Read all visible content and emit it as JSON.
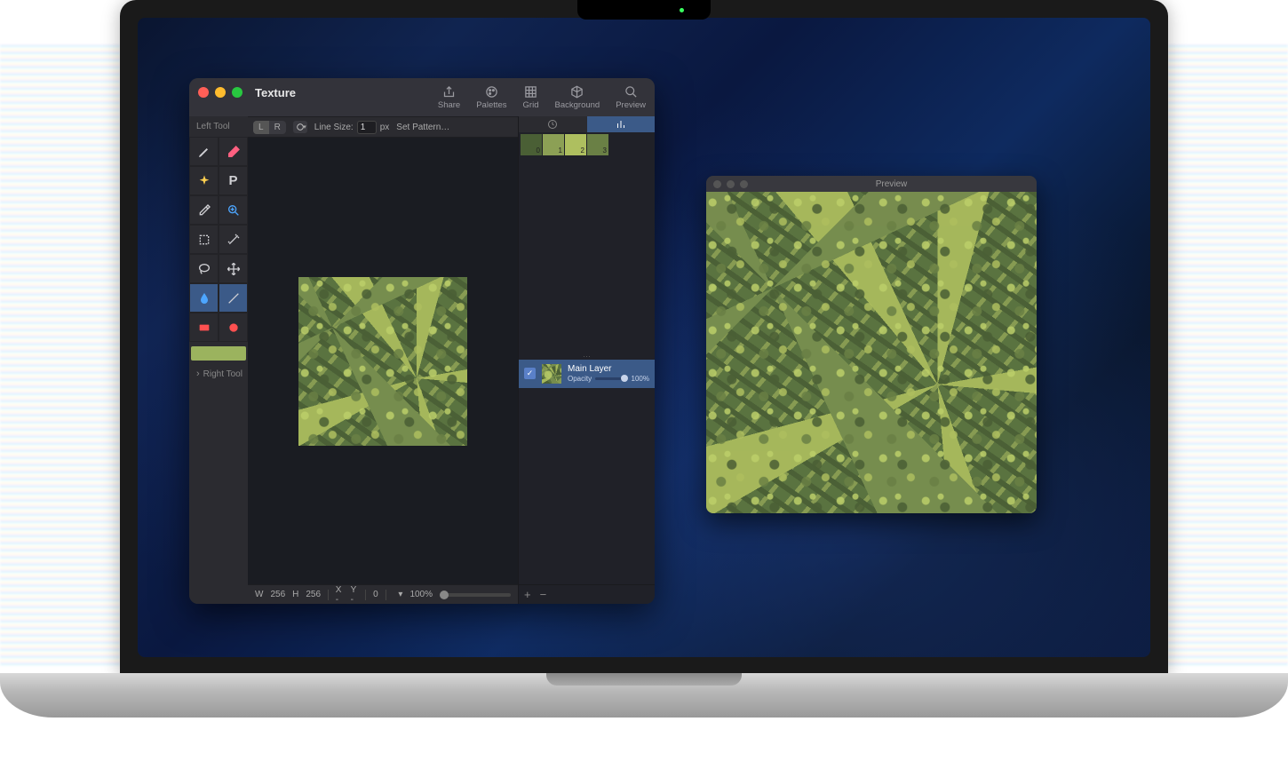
{
  "window": {
    "title": "Texture",
    "toolbar": [
      {
        "id": "share",
        "label": "Share",
        "icon": "share"
      },
      {
        "id": "palettes",
        "label": "Palettes",
        "icon": "palette"
      },
      {
        "id": "grid",
        "label": "Grid",
        "icon": "grid"
      },
      {
        "id": "background",
        "label": "Background",
        "icon": "cube"
      },
      {
        "id": "preview",
        "label": "Preview",
        "icon": "search"
      }
    ]
  },
  "sidebar": {
    "left_tool_label": "Left Tool",
    "right_tool_label": "Right Tool",
    "tools": [
      {
        "id": "pencil",
        "icon": "pencil"
      },
      {
        "id": "eraser",
        "icon": "eraser"
      },
      {
        "id": "sparkle",
        "icon": "sparkle"
      },
      {
        "id": "type",
        "icon": "type"
      },
      {
        "id": "eyedrop",
        "icon": "eyedrop"
      },
      {
        "id": "zoom",
        "icon": "zoom"
      },
      {
        "id": "marquee",
        "icon": "marquee"
      },
      {
        "id": "wand",
        "icon": "wand"
      },
      {
        "id": "lasso",
        "icon": "lasso"
      },
      {
        "id": "move",
        "icon": "move"
      },
      {
        "id": "bucket",
        "icon": "bucket",
        "selected": true
      },
      {
        "id": "line",
        "icon": "line",
        "selected": true
      },
      {
        "id": "rect",
        "icon": "rect"
      },
      {
        "id": "ellipse",
        "icon": "ellipse"
      }
    ],
    "swatch_color": "#9bb35e"
  },
  "options": {
    "lr": [
      "L",
      "R"
    ],
    "lr_selected": "L",
    "line_size_label": "Line Size:",
    "line_size_value": "1",
    "line_size_unit": "px",
    "set_pattern_label": "Set Pattern…"
  },
  "canvas": {
    "w_label": "W",
    "w": "256",
    "h_label": "H",
    "h": "256",
    "x_label": "X -",
    "y_label": "Y -",
    "coord": "0",
    "zoom": "100%"
  },
  "palette": {
    "tabs": [
      "history",
      "palette"
    ],
    "active_tab": 1,
    "swatches": [
      {
        "idx": "0",
        "color": "#4a5f35"
      },
      {
        "idx": "1",
        "color": "#8ca055"
      },
      {
        "idx": "2",
        "color": "#aebf5f"
      },
      {
        "idx": "3",
        "color": "#6a8045"
      }
    ]
  },
  "layers": {
    "main": {
      "name": "Main Layer",
      "opacity_label": "Opacity",
      "opacity_value": "100%",
      "visible": true
    }
  },
  "preview_window": {
    "title": "Preview"
  }
}
